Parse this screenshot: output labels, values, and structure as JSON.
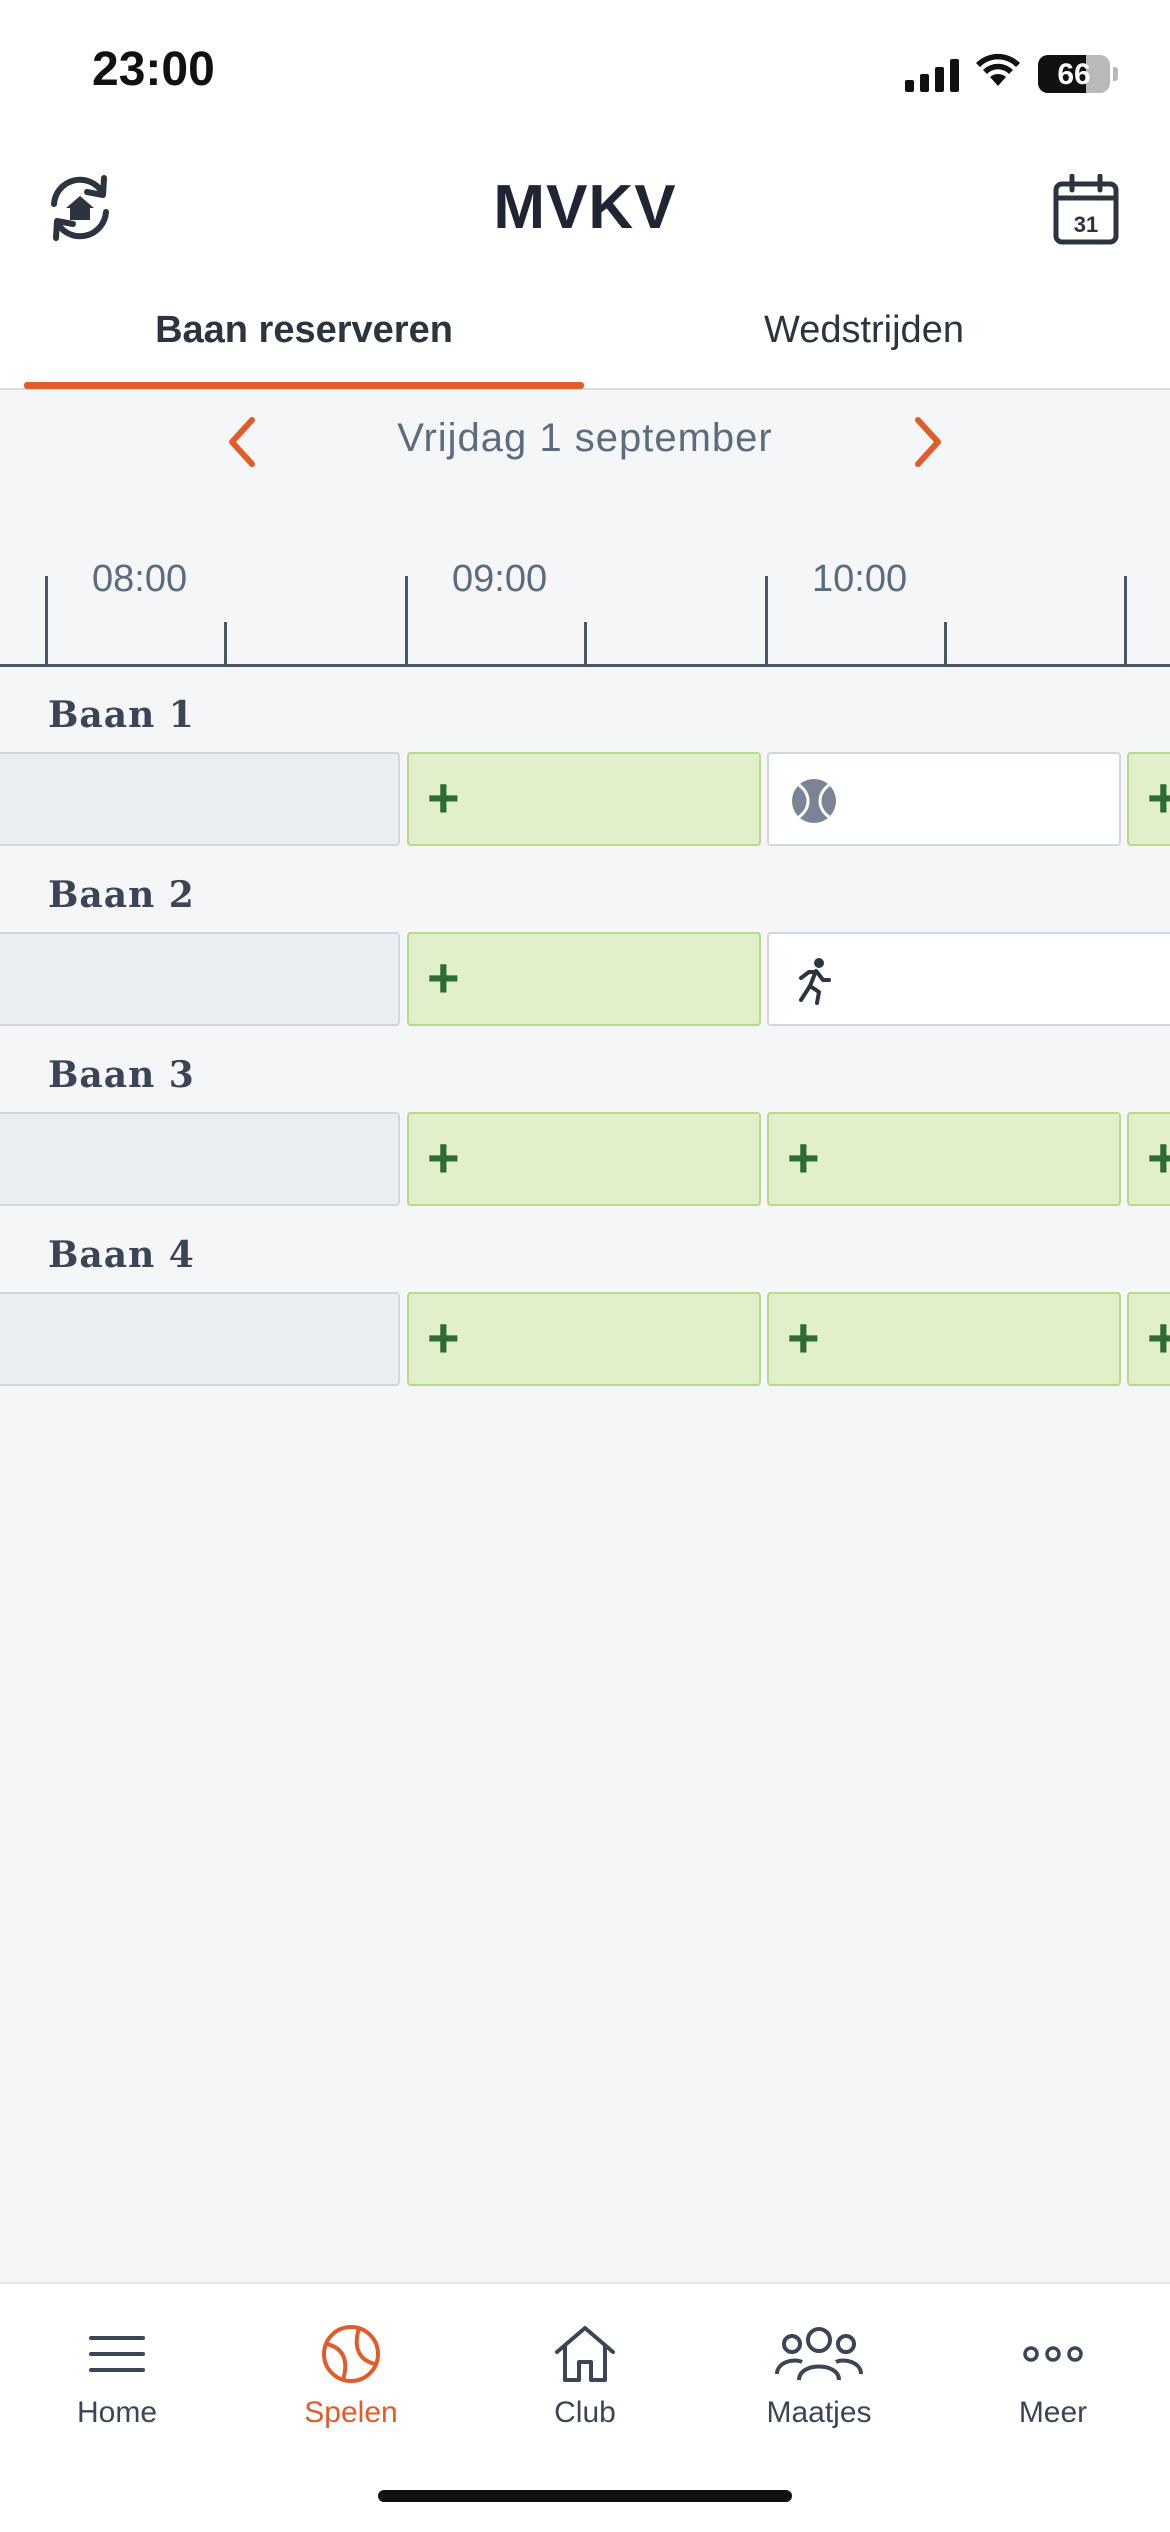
{
  "status_bar": {
    "time": "23:00",
    "battery": "66",
    "battery_level": 0.66
  },
  "header": {
    "title": "MVKV"
  },
  "tabs": [
    {
      "label": "Baan reserveren",
      "active": true
    },
    {
      "label": "Wedstrijden",
      "active": false
    }
  ],
  "date_nav": {
    "label": "Vrijdag 1 september"
  },
  "timeline": {
    "hours": [
      "08:00",
      "09:00",
      "10:00"
    ]
  },
  "courts": [
    {
      "name": "Baan 1",
      "slots": [
        "past",
        "free",
        "booked-tennis",
        "free"
      ]
    },
    {
      "name": "Baan 2",
      "slots": [
        "past",
        "free",
        "booked-training"
      ]
    },
    {
      "name": "Baan 3",
      "slots": [
        "past",
        "free",
        "free",
        "free"
      ]
    },
    {
      "name": "Baan 4",
      "slots": [
        "past",
        "free",
        "free",
        "free"
      ]
    }
  ],
  "slot_symbols": {
    "free": "+"
  },
  "bottom_nav": [
    {
      "label": "Home",
      "icon": "menu-icon",
      "active": false
    },
    {
      "label": "Spelen",
      "icon": "tennis-ball-icon",
      "active": true
    },
    {
      "label": "Club",
      "icon": "house-icon",
      "active": false
    },
    {
      "label": "Maatjes",
      "icon": "people-icon",
      "active": false
    },
    {
      "label": "Meer",
      "icon": "more-icon",
      "active": false
    }
  ],
  "colors": {
    "accent": "#e25b2a",
    "free_slot": "#e1efcb",
    "plus": "#2f6b36",
    "background": "#f4f6f8"
  }
}
